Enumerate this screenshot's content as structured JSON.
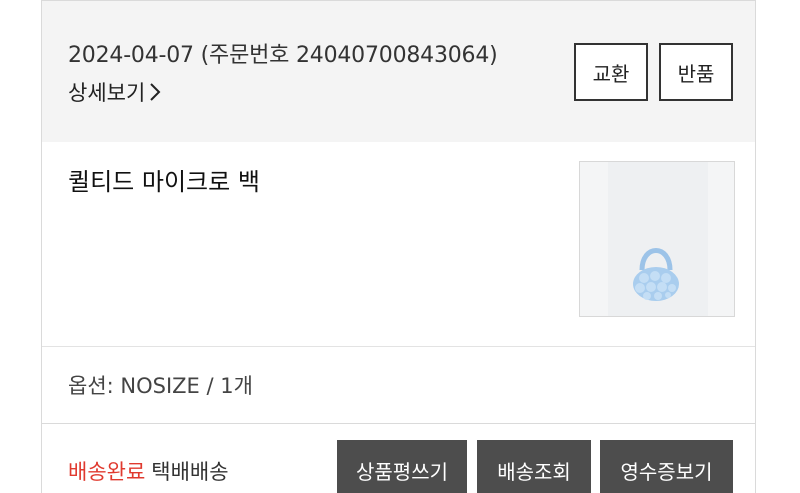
{
  "order": {
    "date": "2024-04-07",
    "number_label": "(주문번호 24040700843064)",
    "detail_link": "상세보기",
    "exchange_button": "교환",
    "return_button": "반품"
  },
  "product": {
    "name": "퀼티드 마이크로 백",
    "option": "옵션: NOSIZE /  1개",
    "image_description_color": "#a9cdee"
  },
  "delivery": {
    "status": "배송완료",
    "method": "택배배송",
    "status_color": "#e03a2f"
  },
  "actions": {
    "review": "상품평쓰기",
    "track": "배송조회",
    "receipt": "영수증보기"
  }
}
